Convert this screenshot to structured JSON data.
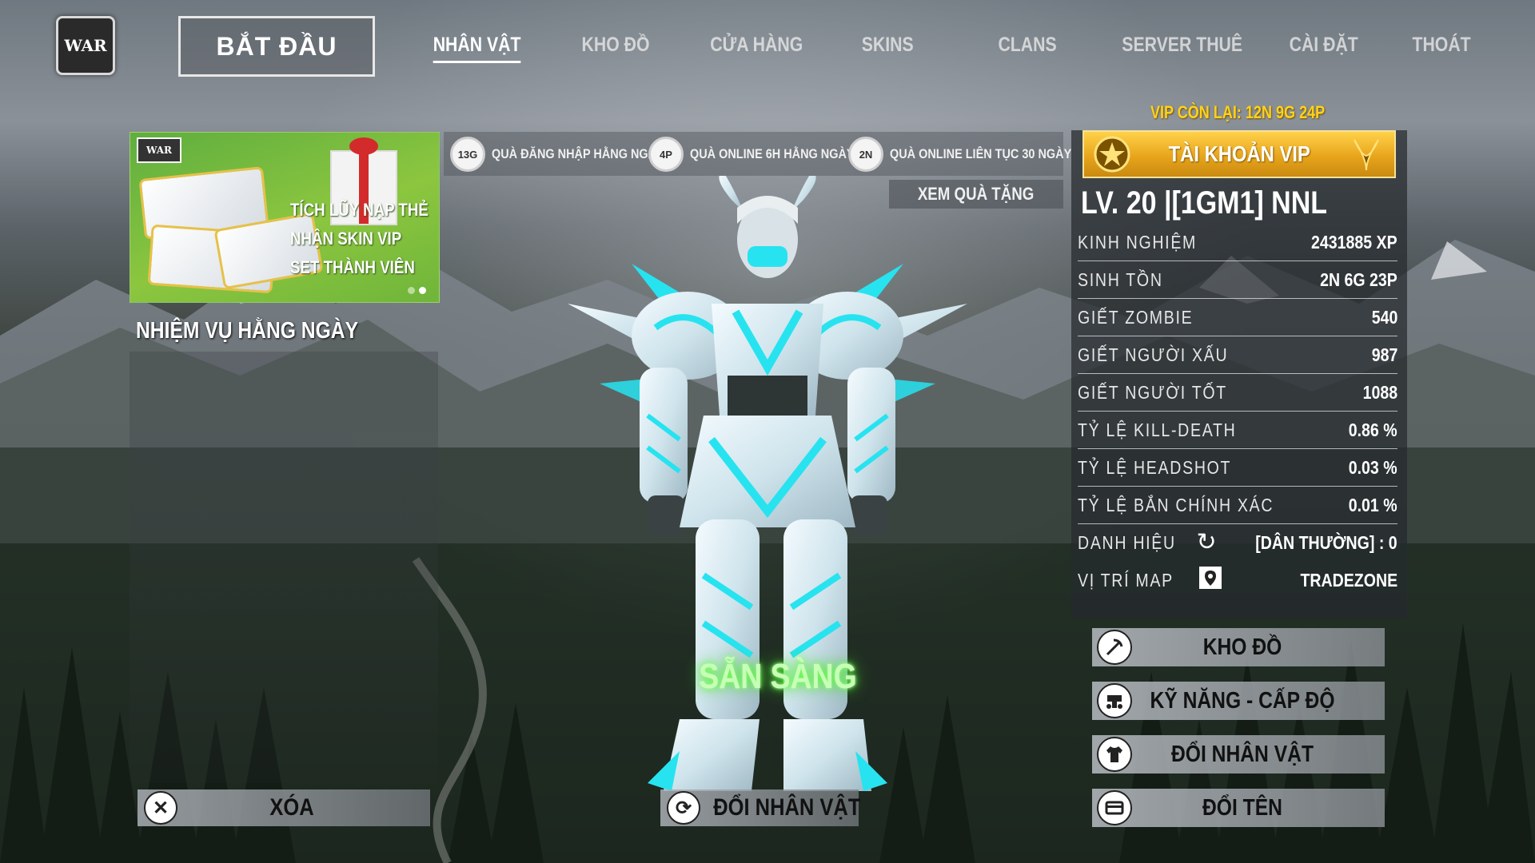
{
  "nav": {
    "start_label": "BẮT ĐẦU",
    "items": [
      {
        "label": "NHÂN VẬT",
        "active": true
      },
      {
        "label": "KHO ĐỒ"
      },
      {
        "label": "CỬA HÀNG"
      },
      {
        "label": "SKINS"
      },
      {
        "label": "CLANS"
      },
      {
        "label": "SERVER THUÊ"
      },
      {
        "label": "CÀI ĐẶT"
      },
      {
        "label": "THOÁT"
      }
    ]
  },
  "promo": {
    "logo_text": "WAR",
    "lines": [
      "TÍCH LŨY NẠP THẺ",
      "NHẬN SKIN VIP",
      "SET THÀNH VIÊN"
    ]
  },
  "missions": {
    "title": "NHIỆM VỤ HẰNG NGÀY"
  },
  "rewards": [
    {
      "badge": "13G",
      "label": "QUÀ ĐĂNG NHẬP HẰNG NGÀY"
    },
    {
      "badge": "4P",
      "label": "QUÀ ONLINE 6H HẰNG NGÀY"
    },
    {
      "badge": "2N",
      "label": "QUÀ ONLINE LIÊN TỤC 30 NGÀY"
    }
  ],
  "view_gifts_label": "XEM QUÀ TẶNG",
  "character": {
    "status": "SẴN SÀNG"
  },
  "bottom": {
    "delete_label": "XÓA",
    "change_char_label": "ĐỔI NHÂN VẬT"
  },
  "vip": {
    "remaining": "VIP CÒN LẠI: 12N 9G 24P",
    "account_label": "TÀI KHOẢN VIP",
    "level_line": "LV. 20  |[1GM1] NNL"
  },
  "stats": [
    {
      "label": "KINH NGHIỆM",
      "value": "2431885 XP"
    },
    {
      "label": "SINH TỒN",
      "value": "2N 6G 23P"
    },
    {
      "label": "GIẾT ZOMBIE",
      "value": "540"
    },
    {
      "label": "GIẾT NGƯỜI XẤU",
      "value": "987"
    },
    {
      "label": "GIẾT NGƯỜI TỐT",
      "value": "1088"
    },
    {
      "label": "TỶ LỆ KILL-DEATH",
      "value": "0.86 %"
    },
    {
      "label": "TỶ LỆ HEADSHOT",
      "value": "0.03 %"
    },
    {
      "label": "TỶ LỆ BẮN CHÍNH XÁC",
      "value": "0.01 %"
    },
    {
      "label": "DANH HIỆU",
      "value": "[DÂN THƯỜNG] : 0",
      "icon": "refresh-icon"
    },
    {
      "label": "VỊ TRÍ MAP",
      "value": "TRADEZONE",
      "icon": "map-pin-icon"
    }
  ],
  "side_buttons": [
    {
      "label": "KHO ĐỒ",
      "icon": "pickaxe-icon"
    },
    {
      "label": "KỸ NĂNG - CẤP ĐỘ",
      "icon": "skills-icon"
    },
    {
      "label": "ĐỔI NHÂN VẬT",
      "icon": "shirt-icon"
    },
    {
      "label": "ĐỔI TÊN",
      "icon": "id-card-icon"
    }
  ],
  "colors": {
    "vip_gold": "#ffd21a",
    "ready_glow": "#5bff3a",
    "armor_cyan": "#27e3f0"
  }
}
